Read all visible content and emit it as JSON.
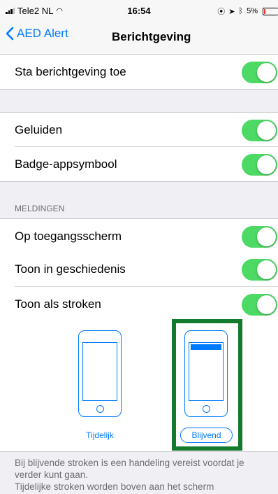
{
  "status_bar": {
    "carrier": "Tele2 NL",
    "time": "16:54",
    "battery": "5%"
  },
  "nav": {
    "back_label": "AED Alert",
    "title": "Berichtgeving"
  },
  "cells": {
    "allow": {
      "label": "Sta berichtgeving toe",
      "on": true
    },
    "sounds": {
      "label": "Geluiden",
      "on": true
    },
    "badge": {
      "label": "Badge-appsymbool",
      "on": true
    }
  },
  "alerts_section": {
    "header": "MELDINGEN",
    "items": [
      {
        "label": "Op toegangsscherm",
        "on": true
      },
      {
        "label": "Toon in geschiedenis",
        "on": true
      },
      {
        "label": "Toon als stroken",
        "on": true
      }
    ]
  },
  "banner_styles": {
    "temporary": "Tijdelijk",
    "persistent": "Blijvend",
    "selected": "Blijvend"
  },
  "footer": {
    "line1": "Bij blijvende stroken is een handeling vereist voordat je",
    "line2": "verder kunt gaan.",
    "line3": "Tijdelijke stroken worden boven aan het scherm"
  },
  "colors": {
    "accent": "#007aff",
    "toggle_on": "#4cd964",
    "highlight": "#147a2e"
  }
}
